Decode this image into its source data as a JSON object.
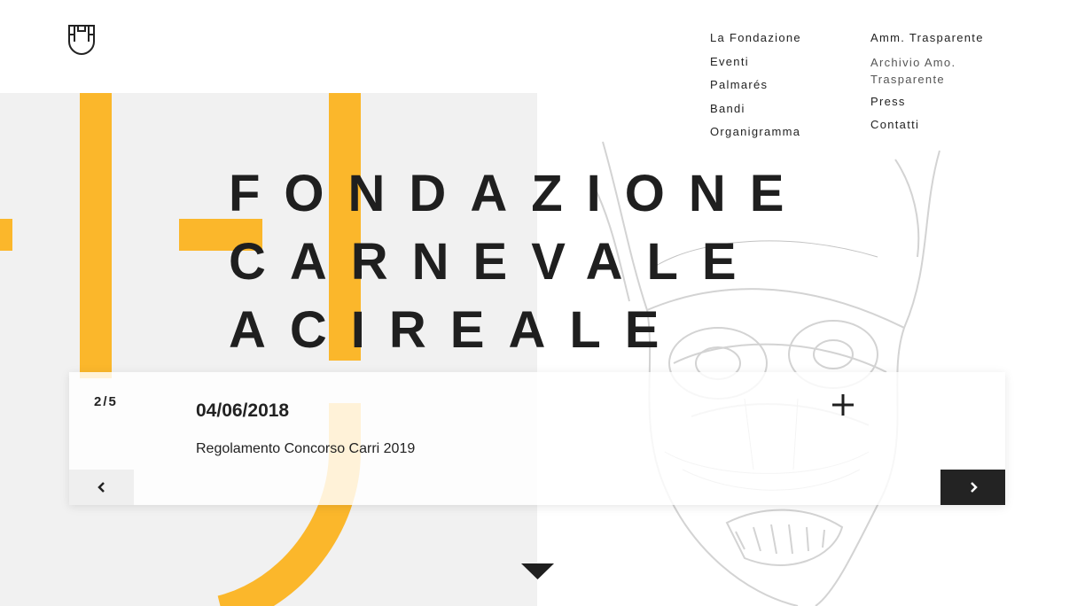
{
  "header": {
    "logo_icon": "mask-logo-icon",
    "nav_left": [
      {
        "label": "La Fondazione"
      },
      {
        "label": "Eventi"
      },
      {
        "label": "Palmarés"
      },
      {
        "label": "Bandi"
      },
      {
        "label": "Organigramma"
      }
    ],
    "nav_right": [
      {
        "label": "Amm. Trasparente"
      },
      {
        "label": "Archivio Amo. Trasparente"
      },
      {
        "label": "Press"
      },
      {
        "label": "Contatti"
      }
    ]
  },
  "hero": {
    "line1": "FONDAZIONE",
    "line2": "CARNEVALE",
    "line3": "ACIREALE"
  },
  "slider": {
    "counter": "2/5",
    "date": "04/06/2018",
    "title": "Regolamento Concorso Carri 2019",
    "plus_icon": "plus-icon",
    "prev_icon": "chevron-left-icon",
    "next_icon": "chevron-right-icon"
  },
  "scroll_icon": "triangle-down-icon",
  "colors": {
    "accent": "#fbb72b",
    "text": "#222222",
    "panel": "#f1f1f1",
    "dark_button": "#232323"
  }
}
